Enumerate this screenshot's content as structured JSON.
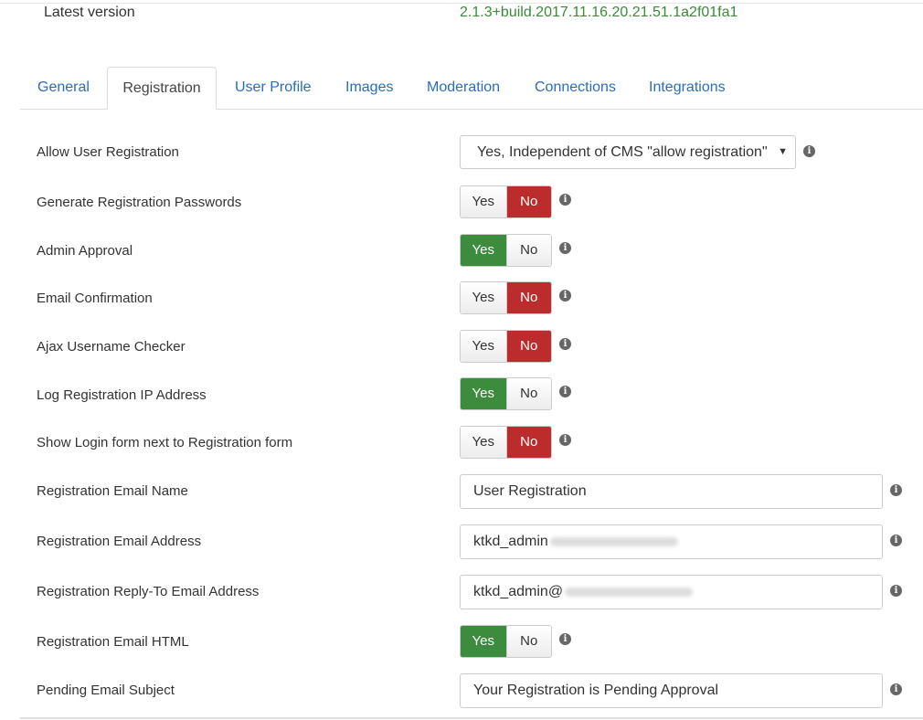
{
  "header": {
    "latest_version_label": "Latest version",
    "latest_version_value": "2.1.3+build.2017.11.16.20.21.51.1a2f01fa1"
  },
  "tabs": [
    {
      "label": "General"
    },
    {
      "label": "Registration"
    },
    {
      "label": "User Profile"
    },
    {
      "label": "Images"
    },
    {
      "label": "Moderation"
    },
    {
      "label": "Connections"
    },
    {
      "label": "Integrations"
    }
  ],
  "active_tab": "Registration",
  "colors": {
    "yes_active": "#3d8b3d",
    "no_active": "#bd2c2c",
    "link": "#2a6ebb",
    "version": "#3a8a3a"
  },
  "icons": {
    "info": "info-icon",
    "caret": "caret-down-icon"
  },
  "toggle_labels": {
    "yes": "Yes",
    "no": "No"
  },
  "settings": {
    "allow_user_registration": {
      "label": "Allow User Registration",
      "value": "Yes, Independent of CMS \"allow registration\""
    },
    "generate_registration_passwords": {
      "label": "Generate Registration Passwords",
      "value": "No"
    },
    "admin_approval": {
      "label": "Admin Approval",
      "value": "Yes"
    },
    "email_confirmation": {
      "label": "Email Confirmation",
      "value": "No"
    },
    "ajax_username_checker": {
      "label": "Ajax Username Checker",
      "value": "No"
    },
    "log_registration_ip": {
      "label": "Log Registration IP Address",
      "value": "Yes"
    },
    "show_login_form": {
      "label": "Show Login form next to Registration form",
      "value": "No"
    },
    "registration_email_name": {
      "label": "Registration Email Name",
      "value": "User Registration"
    },
    "registration_email_address": {
      "label": "Registration Email Address",
      "value": "ktkd_admin"
    },
    "registration_reply_to": {
      "label": "Registration Reply-To Email Address",
      "value": "ktkd_admin@"
    },
    "registration_email_html": {
      "label": "Registration Email HTML",
      "value": "Yes"
    },
    "pending_email_subject": {
      "label": "Pending Email Subject",
      "value": "Your Registration is Pending Approval"
    }
  }
}
